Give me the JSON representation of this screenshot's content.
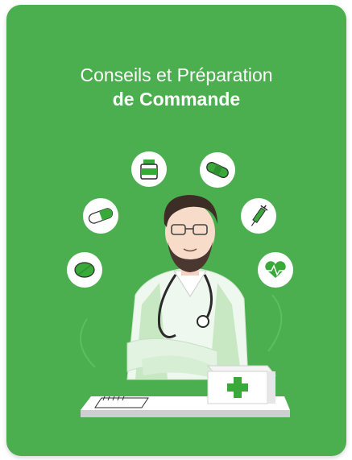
{
  "card": {
    "title_line1": "Conseils et Préparation",
    "title_line2": "de Commande",
    "background_color": "#4caf4f",
    "accent_color": "#39a93a"
  },
  "illustration": {
    "subject": "pharmacist-icon",
    "icons": [
      "pill-bottle-icon",
      "bandage-icon",
      "capsule-icon",
      "syringe-icon",
      "tablet-icon",
      "heart-pulse-icon",
      "medical-box-icon",
      "notebook-icon"
    ]
  }
}
